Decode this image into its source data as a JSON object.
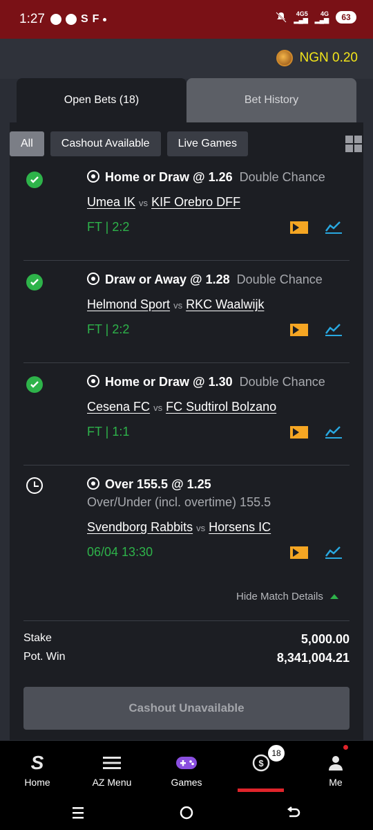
{
  "status_bar": {
    "time": "1:27",
    "net1": "4G5",
    "net2": "4G",
    "battery": "63"
  },
  "header": {
    "balance": "NGN 0.20"
  },
  "tabs": [
    {
      "label": "Open Bets (18)",
      "active": true
    },
    {
      "label": "Bet History",
      "active": false
    }
  ],
  "filters": [
    "All",
    "Cashout Available",
    "Live Games"
  ],
  "bets": [
    {
      "status": "won",
      "pick": "Home or Draw @ 1.26",
      "market": "Double Chance",
      "home": "Umea IK",
      "vs": "vs",
      "away": "KIF Orebro DFF",
      "result": "FT | 2:2"
    },
    {
      "status": "won",
      "pick": "Draw or Away @ 1.28",
      "market": "Double Chance",
      "home": "Helmond Sport",
      "vs": "vs",
      "away": "RKC Waalwijk",
      "result": "FT | 2:2"
    },
    {
      "status": "won",
      "pick": "Home or Draw @ 1.30",
      "market": "Double Chance",
      "home": "Cesena FC",
      "vs": "vs",
      "away": "FC Sudtirol Bolzano",
      "result": "FT | 1:1"
    },
    {
      "status": "pending",
      "pick": "Over 155.5 @ 1.25",
      "market": "Over/Under (incl. overtime) 155.5",
      "home": "Svendborg Rabbits",
      "vs": "vs",
      "away": "Horsens IC",
      "result": "06/04 13:30"
    }
  ],
  "hide_details": "Hide Match Details",
  "summary": {
    "stake_label": "Stake",
    "stake": "5,000.00",
    "potwin_label": "Pot. Win",
    "potwin": "8,341,004.21"
  },
  "cashout_button": "Cashout Unavailable",
  "nav": {
    "home": "Home",
    "az": "AZ Menu",
    "games": "Games",
    "badge": "18",
    "me": "Me"
  },
  "colors": {
    "accent_green": "#2eb34a",
    "balance_yellow": "#f3e51a",
    "ticket_orange": "#f5a623",
    "chart_blue": "#29a8e0",
    "active_red": "#e0242b"
  }
}
